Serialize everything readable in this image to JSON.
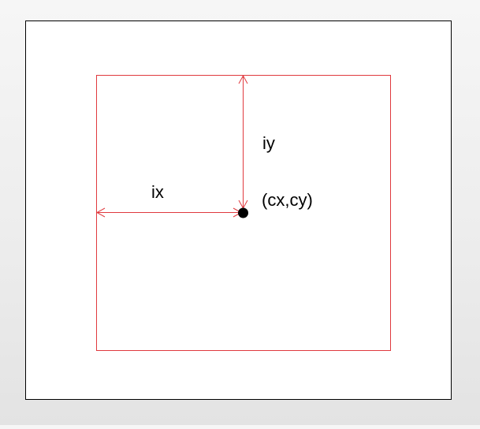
{
  "labels": {
    "ix": "ix",
    "iy": "iy",
    "center": "(cx,cy)"
  },
  "colors": {
    "background": "#ffffff",
    "outer_border": "#000000",
    "inner_rect": "#e0393e",
    "arrow": "#e0393e",
    "center_point": "#000000",
    "text": "#000000"
  }
}
